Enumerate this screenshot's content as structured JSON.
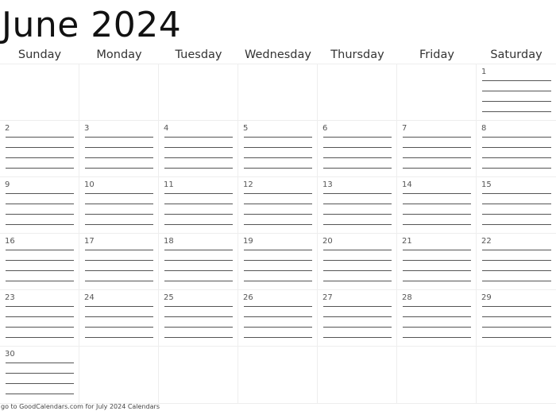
{
  "title": "June 2024",
  "weekdays": [
    "Sunday",
    "Monday",
    "Tuesday",
    "Wednesday",
    "Thursday",
    "Friday",
    "Saturday"
  ],
  "weeks": [
    [
      "",
      "",
      "",
      "",
      "",
      "",
      "1"
    ],
    [
      "2",
      "3",
      "4",
      "5",
      "6",
      "7",
      "8"
    ],
    [
      "9",
      "10",
      "11",
      "12",
      "13",
      "14",
      "15"
    ],
    [
      "16",
      "17",
      "18",
      "19",
      "20",
      "21",
      "22"
    ],
    [
      "23",
      "24",
      "25",
      "26",
      "27",
      "28",
      "29"
    ],
    [
      "30",
      "",
      "",
      "",
      "",
      "",
      ""
    ]
  ],
  "footer": "go to GoodCalendars.com for July 2024 Calendars"
}
